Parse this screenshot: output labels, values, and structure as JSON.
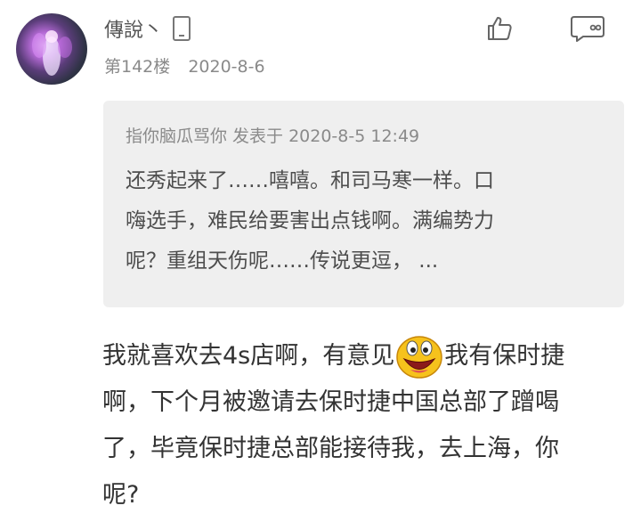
{
  "post": {
    "username": "傳說丶",
    "floor": "第142楼",
    "date": "2020-8-6",
    "icons": {
      "avatar": "user-avatar",
      "device": "phone-icon",
      "like": "thumb-up-icon",
      "reply": "comment-icon"
    }
  },
  "quote": {
    "header": "指你脑瓜骂你 发表于 2020-8-5 12:49",
    "lines": [
      " 还秀起来了……嘻嘻。和司马寒一样。口",
      "嗨选手，难民给要害出点钱啊。满编势力",
      "呢？重组天伤呢……传说更逗， ..."
    ]
  },
  "body": {
    "line1_before": "我就喜欢去4s店啊，有意见",
    "line1_after": "我有保时捷",
    "line2": "啊，下个月被邀请去保时捷中国总部了蹭喝",
    "line3": "了，毕竟保时捷总部能接待我，去上海，你",
    "line4": "呢?",
    "emoji": "laughing-smiley-emoji"
  }
}
